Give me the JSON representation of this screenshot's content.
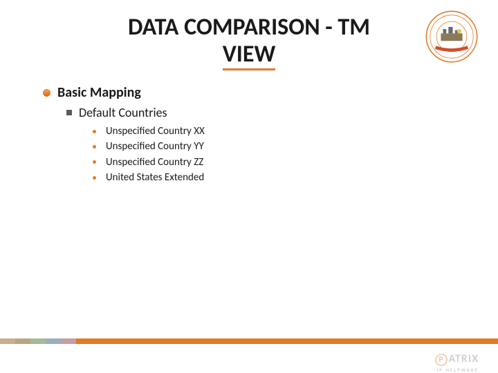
{
  "title_line1": "DATA COMPARISON - TM",
  "title_line2": "VIEW",
  "section": {
    "heading": "Basic Mapping",
    "sub": {
      "heading": "Default Countries",
      "items": [
        "Unspecified Country XX",
        "Unspecified Country YY",
        "Unspecified Country ZZ",
        "United States Extended"
      ]
    }
  },
  "logo": {
    "p": "P",
    "text": "ATRIX",
    "sub": "IP HELPWARE"
  },
  "footer_colors": [
    "#c9b08a",
    "#b8a67f",
    "#a8b89b",
    "#9ab0b8",
    "#c2a0a0"
  ]
}
